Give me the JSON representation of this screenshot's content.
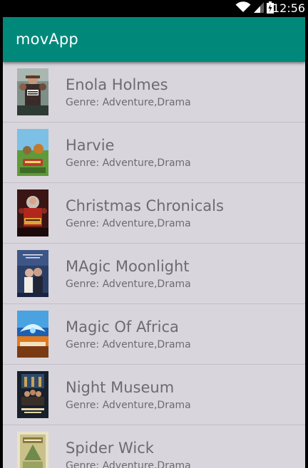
{
  "status_bar": {
    "time": "12:56",
    "icons": [
      "wifi-icon",
      "signal-icon",
      "battery-icon"
    ]
  },
  "app_bar": {
    "title": "movApp",
    "color": "#00897b"
  },
  "movies": [
    {
      "title": "Enola Holmes",
      "genre": "Genre: Adventure,Drama",
      "poster_icon": "enola-holmes-poster"
    },
    {
      "title": "Harvie",
      "genre": "Genre: Adventure,Drama",
      "poster_icon": "harvie-poster"
    },
    {
      "title": "Christmas Chronicals",
      "genre": "Genre: Adventure,Drama",
      "poster_icon": "christmas-chronicals-poster"
    },
    {
      "title": "MAgic Moonlight",
      "genre": "Genre: Adventure,Drama",
      "poster_icon": "magic-moonlight-poster"
    },
    {
      "title": "Magic Of Africa",
      "genre": "Genre: Adventure,Drama",
      "poster_icon": "magic-of-africa-poster"
    },
    {
      "title": "Night Museum",
      "genre": "Genre: Adventure,Drama",
      "poster_icon": "night-museum-poster"
    },
    {
      "title": "Spider Wick",
      "genre": "Genre: Adventure,Drama",
      "poster_icon": "spider-wick-poster"
    }
  ],
  "colors": {
    "list_background": "#d9d5dc",
    "text": "#6d6b70",
    "divider": "#c3bec7"
  }
}
